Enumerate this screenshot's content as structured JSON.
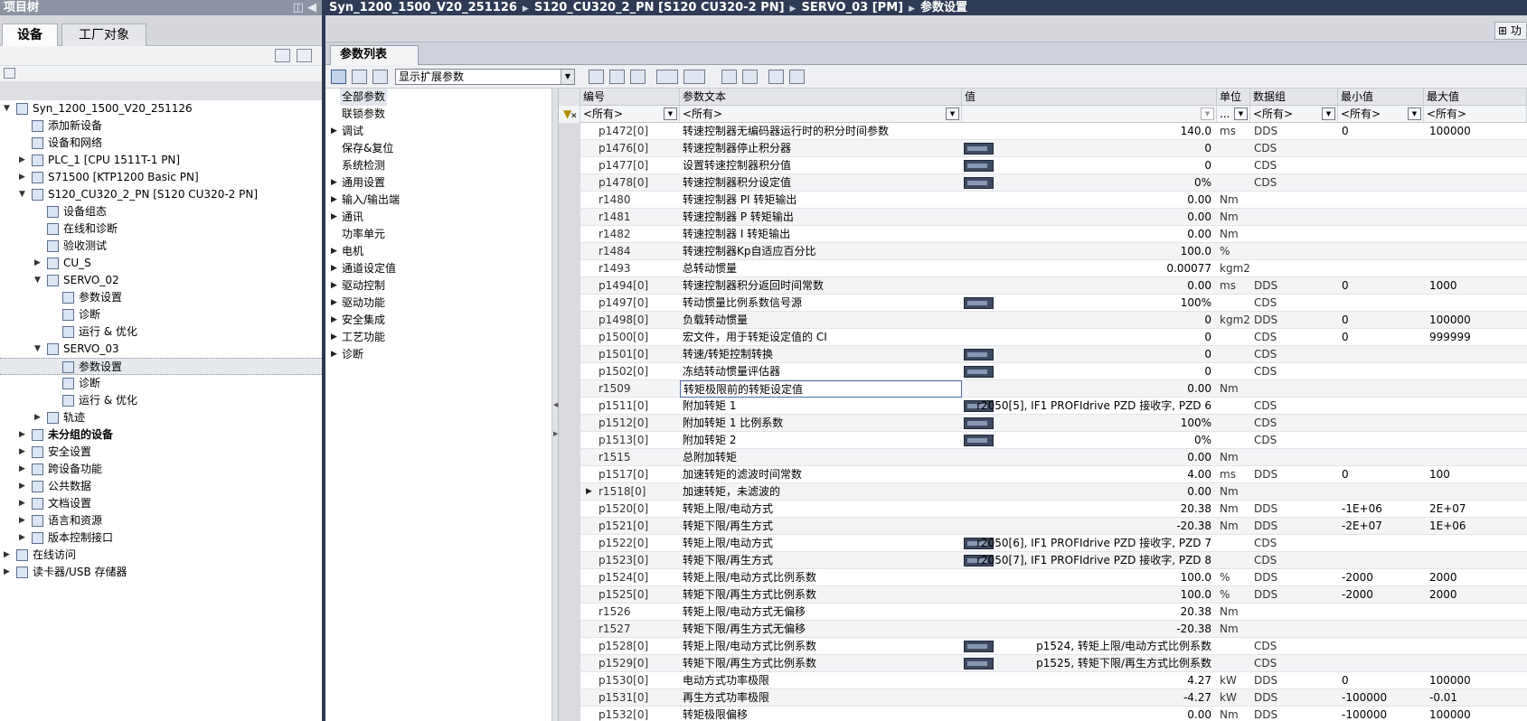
{
  "tree": {
    "header_title": "项目树",
    "header_controls": "◫ ◀",
    "tabs": [
      "设备",
      "工厂对象"
    ],
    "items": [
      {
        "label": "Syn_1200_1500_V20_251126",
        "indent": 0,
        "expand": "▼",
        "bold": false
      },
      {
        "label": "添加新设备",
        "indent": 1,
        "expand": "",
        "bold": false
      },
      {
        "label": "设备和网络",
        "indent": 1,
        "expand": "",
        "bold": false
      },
      {
        "label": "PLC_1 [CPU 1511T-1 PN]",
        "indent": 1,
        "expand": "▶",
        "bold": false
      },
      {
        "label": "S71500 [KTP1200 Basic PN]",
        "indent": 1,
        "expand": "▶",
        "bold": false
      },
      {
        "label": "S120_CU320_2_PN [S120 CU320-2 PN]",
        "indent": 1,
        "expand": "▼",
        "bold": false
      },
      {
        "label": "设备组态",
        "indent": 2,
        "expand": "",
        "bold": false
      },
      {
        "label": "在线和诊断",
        "indent": 2,
        "expand": "",
        "bold": false
      },
      {
        "label": "验收测试",
        "indent": 2,
        "expand": "",
        "bold": false
      },
      {
        "label": "CU_S",
        "indent": 2,
        "expand": "▶",
        "bold": false
      },
      {
        "label": "SERVO_02",
        "indent": 2,
        "expand": "▼",
        "bold": false
      },
      {
        "label": "参数设置",
        "indent": 3,
        "expand": "",
        "bold": false
      },
      {
        "label": "诊断",
        "indent": 3,
        "expand": "",
        "bold": false
      },
      {
        "label": "运行 & 优化",
        "indent": 3,
        "expand": "",
        "bold": false
      },
      {
        "label": "SERVO_03",
        "indent": 2,
        "expand": "▼",
        "bold": false
      },
      {
        "label": "参数设置",
        "indent": 3,
        "expand": "",
        "bold": false,
        "selected": true
      },
      {
        "label": "诊断",
        "indent": 3,
        "expand": "",
        "bold": false
      },
      {
        "label": "运行 & 优化",
        "indent": 3,
        "expand": "",
        "bold": false
      },
      {
        "label": "轨迹",
        "indent": 2,
        "expand": "▶",
        "bold": false
      },
      {
        "label": "未分组的设备",
        "indent": 1,
        "expand": "▶",
        "bold": true
      },
      {
        "label": "安全设置",
        "indent": 1,
        "expand": "▶",
        "bold": false
      },
      {
        "label": "跨设备功能",
        "indent": 1,
        "expand": "▶",
        "bold": false
      },
      {
        "label": "公共数据",
        "indent": 1,
        "expand": "▶",
        "bold": false
      },
      {
        "label": "文档设置",
        "indent": 1,
        "expand": "▶",
        "bold": false
      },
      {
        "label": "语言和资源",
        "indent": 1,
        "expand": "▶",
        "bold": false
      },
      {
        "label": "版本控制接口",
        "indent": 1,
        "expand": "▶",
        "bold": false
      },
      {
        "label": "在线访问",
        "indent": 0,
        "expand": "▶",
        "bold": false
      },
      {
        "label": "读卡器/USB 存储器",
        "indent": 0,
        "expand": "▶",
        "bold": false
      }
    ]
  },
  "breadcrumb": [
    "Syn_1200_1500_V20_251126",
    "S120_CU320_2_PN [S120 CU320-2 PN]",
    "SERVO_03 [PM]",
    "参数设置"
  ],
  "breadcrumb_sep": "▶",
  "strip_button": "功",
  "tab_label": "参数列表",
  "view_select": "显示扩展参数",
  "categories": [
    {
      "label": "全部参数",
      "expand": "",
      "selected": true
    },
    {
      "label": "联锁参数",
      "expand": ""
    },
    {
      "label": "调试",
      "expand": "▶"
    },
    {
      "label": "保存&复位",
      "expand": ""
    },
    {
      "label": "系统检测",
      "expand": ""
    },
    {
      "label": "通用设置",
      "expand": "▶"
    },
    {
      "label": "输入/输出端",
      "expand": "▶"
    },
    {
      "label": "通讯",
      "expand": "▶"
    },
    {
      "label": "功率单元",
      "expand": ""
    },
    {
      "label": "电机",
      "expand": "▶"
    },
    {
      "label": "通道设定值",
      "expand": "▶"
    },
    {
      "label": "驱动控制",
      "expand": "▶"
    },
    {
      "label": "驱动功能",
      "expand": "▶"
    },
    {
      "label": "安全集成",
      "expand": "▶"
    },
    {
      "label": "工艺功能",
      "expand": "▶"
    },
    {
      "label": "诊断",
      "expand": "▶"
    }
  ],
  "grid": {
    "headers": {
      "num": "编号",
      "text": "参数文本",
      "value": "值",
      "unit": "单位",
      "dataset": "数据组",
      "min": "最小值",
      "max": "最大值"
    },
    "filters": {
      "num": "<所有>",
      "text": "<所有>",
      "value": "",
      "unit": "...",
      "dataset": "<所有>",
      "min": "<所有>",
      "max": "<所有>"
    },
    "rows": [
      {
        "num": "p1472[0]",
        "text": "转速控制器无编码器运行时的积分时间参数",
        "value": "140.0",
        "unit": "ms",
        "ds": "DDS",
        "min": "0",
        "max": "100000"
      },
      {
        "num": "p1476[0]",
        "text": "转速控制器停止积分器",
        "value": "0",
        "unit": "",
        "ds": "CDS",
        "min": "",
        "max": "",
        "btn": true
      },
      {
        "num": "p1477[0]",
        "text": "设置转速控制器积分值",
        "value": "0",
        "unit": "",
        "ds": "CDS",
        "min": "",
        "max": "",
        "btn": true
      },
      {
        "num": "p1478[0]",
        "text": "转速控制器积分设定值",
        "value": "0%",
        "unit": "",
        "ds": "CDS",
        "min": "",
        "max": "",
        "btn": true
      },
      {
        "num": "r1480",
        "text": "转速控制器 PI 转矩输出",
        "value": "0.00",
        "unit": "Nm",
        "ds": "",
        "min": "",
        "max": ""
      },
      {
        "num": "r1481",
        "text": "转速控制器 P 转矩输出",
        "value": "0.00",
        "unit": "Nm",
        "ds": "",
        "min": "",
        "max": ""
      },
      {
        "num": "r1482",
        "text": "转速控制器 I 转矩输出",
        "value": "0.00",
        "unit": "Nm",
        "ds": "",
        "min": "",
        "max": ""
      },
      {
        "num": "r1484",
        "text": "转速控制器Kp自适应百分比",
        "value": "100.0",
        "unit": "%",
        "ds": "",
        "min": "",
        "max": ""
      },
      {
        "num": "r1493",
        "text": "总转动惯量",
        "value": "0.00077",
        "unit": "kgm2",
        "ds": "",
        "min": "",
        "max": ""
      },
      {
        "num": "p1494[0]",
        "text": "转速控制器积分返回时间常数",
        "value": "0.00",
        "unit": "ms",
        "ds": "DDS",
        "min": "0",
        "max": "1000"
      },
      {
        "num": "p1497[0]",
        "text": "转动惯量比例系数信号源",
        "value": "100%",
        "unit": "",
        "ds": "CDS",
        "min": "",
        "max": "",
        "btn": true
      },
      {
        "num": "p1498[0]",
        "text": "负载转动惯量",
        "value": "0",
        "unit": "kgm2",
        "ds": "DDS",
        "min": "0",
        "max": "100000"
      },
      {
        "num": "p1500[0]",
        "text": "宏文件，用于转矩设定值的 CI",
        "value": "0",
        "unit": "",
        "ds": "CDS",
        "min": "0",
        "max": "999999"
      },
      {
        "num": "p1501[0]",
        "text": "转速/转矩控制转换",
        "value": "0",
        "unit": "",
        "ds": "CDS",
        "min": "",
        "max": "",
        "btn": true
      },
      {
        "num": "p1502[0]",
        "text": "冻结转动惯量评估器",
        "value": "0",
        "unit": "",
        "ds": "CDS",
        "min": "",
        "max": "",
        "btn": true
      },
      {
        "num": "r1509",
        "text": "转矩极限前的转矩设定值",
        "value": "0.00",
        "unit": "Nm",
        "ds": "",
        "min": "",
        "max": "",
        "focus": true
      },
      {
        "num": "p1511[0]",
        "text": "附加转矩 1",
        "value": "r2050[5], IF1 PROFIdrive PZD 接收字, PZD 6",
        "unit": "",
        "ds": "CDS",
        "min": "",
        "max": "",
        "btn": true
      },
      {
        "num": "p1512[0]",
        "text": "附加转矩 1 比例系数",
        "value": "100%",
        "unit": "",
        "ds": "CDS",
        "min": "",
        "max": "",
        "btn": true
      },
      {
        "num": "p1513[0]",
        "text": "附加转矩 2",
        "value": "0%",
        "unit": "",
        "ds": "CDS",
        "min": "",
        "max": "",
        "btn": true
      },
      {
        "num": "r1515",
        "text": "总附加转矩",
        "value": "0.00",
        "unit": "Nm",
        "ds": "",
        "min": "",
        "max": ""
      },
      {
        "num": "p1517[0]",
        "text": "加速转矩的滤波时间常数",
        "value": "4.00",
        "unit": "ms",
        "ds": "DDS",
        "min": "0",
        "max": "100"
      },
      {
        "num": "r1518[0]",
        "text": "加速转矩，未滤波的",
        "value": "0.00",
        "unit": "Nm",
        "ds": "",
        "min": "",
        "max": "",
        "expand": true
      },
      {
        "num": "p1520[0]",
        "text": "转矩上限/电动方式",
        "value": "20.38",
        "unit": "Nm",
        "ds": "DDS",
        "min": "-1E+06",
        "max": "2E+07"
      },
      {
        "num": "p1521[0]",
        "text": "转矩下限/再生方式",
        "value": "-20.38",
        "unit": "Nm",
        "ds": "DDS",
        "min": "-2E+07",
        "max": "1E+06"
      },
      {
        "num": "p1522[0]",
        "text": "转矩上限/电动方式",
        "value": "r2050[6], IF1 PROFIdrive PZD 接收字, PZD 7",
        "unit": "",
        "ds": "CDS",
        "min": "",
        "max": "",
        "btn": true
      },
      {
        "num": "p1523[0]",
        "text": "转矩下限/再生方式",
        "value": "r2050[7], IF1 PROFIdrive PZD 接收字, PZD 8",
        "unit": "",
        "ds": "CDS",
        "min": "",
        "max": "",
        "btn": true
      },
      {
        "num": "p1524[0]",
        "text": "转矩上限/电动方式比例系数",
        "value": "100.0",
        "unit": "%",
        "ds": "DDS",
        "min": "-2000",
        "max": "2000"
      },
      {
        "num": "p1525[0]",
        "text": "转矩下限/再生方式比例系数",
        "value": "100.0",
        "unit": "%",
        "ds": "DDS",
        "min": "-2000",
        "max": "2000"
      },
      {
        "num": "r1526",
        "text": "转矩上限/电动方式无偏移",
        "value": "20.38",
        "unit": "Nm",
        "ds": "",
        "min": "",
        "max": ""
      },
      {
        "num": "r1527",
        "text": "转矩下限/再生方式无偏移",
        "value": "-20.38",
        "unit": "Nm",
        "ds": "",
        "min": "",
        "max": ""
      },
      {
        "num": "p1528[0]",
        "text": "转矩上限/电动方式比例系数",
        "value": "p1524, 转矩上限/电动方式比例系数",
        "unit": "",
        "ds": "CDS",
        "min": "",
        "max": "",
        "btn": true
      },
      {
        "num": "p1529[0]",
        "text": "转矩下限/再生方式比例系数",
        "value": "p1525, 转矩下限/再生方式比例系数",
        "unit": "",
        "ds": "CDS",
        "min": "",
        "max": "",
        "btn": true
      },
      {
        "num": "p1530[0]",
        "text": "电动方式功率极限",
        "value": "4.27",
        "unit": "kW",
        "ds": "DDS",
        "min": "0",
        "max": "100000"
      },
      {
        "num": "p1531[0]",
        "text": "再生方式功率极限",
        "value": "-4.27",
        "unit": "kW",
        "ds": "DDS",
        "min": "-100000",
        "max": "-0.01"
      },
      {
        "num": "p1532[0]",
        "text": "转矩极限偏移",
        "value": "0.00",
        "unit": "Nm",
        "ds": "DDS",
        "min": "-100000",
        "max": "100000"
      }
    ]
  }
}
